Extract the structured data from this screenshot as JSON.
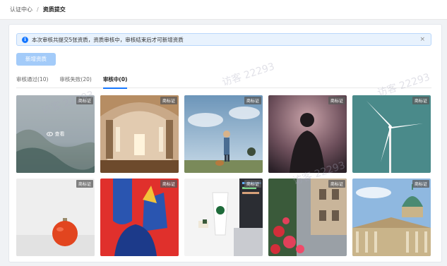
{
  "breadcrumb": {
    "home": "认证中心",
    "separator": "/",
    "current": "资质提交"
  },
  "alert": {
    "text": "本次审核共提交5张资质，资质审核中，审核结束后才可新增资质",
    "close": "×"
  },
  "add_button": "新增资质",
  "tabs": [
    {
      "label": "审核通过(10)"
    },
    {
      "label": "审核失败(20)"
    },
    {
      "label": "审核中(0)"
    }
  ],
  "badge_label": "商标证",
  "view_label": "查看",
  "watermark": "访客 22293",
  "cards": [
    {
      "subject": "misty-mountain"
    },
    {
      "subject": "church-interior"
    },
    {
      "subject": "person-with-dog"
    },
    {
      "subject": "portrait-silhouette"
    },
    {
      "subject": "wind-turbine"
    },
    {
      "subject": "red-ornament"
    },
    {
      "subject": "red-blue-art"
    },
    {
      "subject": "laptop-coffee"
    },
    {
      "subject": "flowered-street"
    },
    {
      "subject": "domed-building"
    }
  ],
  "colors": {
    "accent": "#1677ff",
    "alert_bg": "#e8f2fd",
    "button_disabled": "#a3cbf9"
  }
}
